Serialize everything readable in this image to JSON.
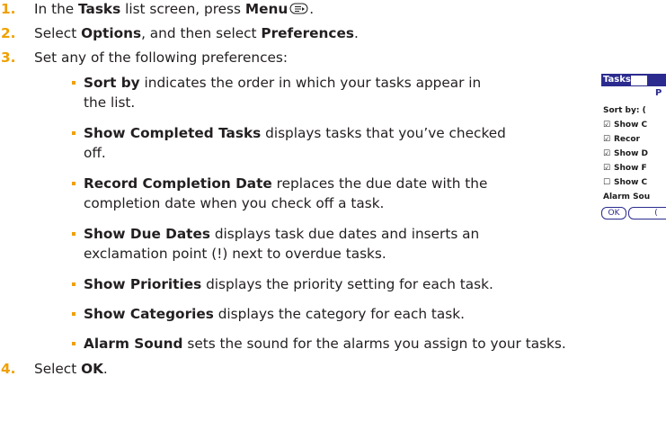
{
  "steps": [
    {
      "num": "1.",
      "pre": "In the ",
      "b1": "Tasks",
      "mid": " list screen, press ",
      "b2": "Menu",
      "post": "."
    },
    {
      "num": "2.",
      "pre": "Select ",
      "b1": "Options",
      "mid": ", and then select ",
      "b2": "Preferences",
      "post": "."
    },
    {
      "num": "3.",
      "text": "Set any of the following preferences:"
    },
    {
      "num": "4.",
      "pre": "Select ",
      "b1": "OK",
      "post": "."
    }
  ],
  "prefs": [
    {
      "term": "Sort by",
      "lines": [
        " indicates the order in which your tasks appear in",
        "the list."
      ]
    },
    {
      "term": "Show Completed Tasks",
      "lines": [
        " displays tasks that you’ve checked",
        "off."
      ]
    },
    {
      "term": "Record Completion Date",
      "lines": [
        " replaces the due date with the",
        "completion date when you check off a task."
      ]
    },
    {
      "term": "Show Due Dates",
      "lines": [
        " displays task due dates and inserts an",
        "exclamation point (!) next to overdue tasks."
      ]
    },
    {
      "term": "Show Priorities",
      "lines": [
        " displays the priority setting for each task."
      ]
    },
    {
      "term": "Show Categories",
      "lines": [
        " displays the category for each task."
      ]
    },
    {
      "term": "Alarm Sound",
      "lines": [
        " sets the sound for the alarms you assign to your tasks."
      ]
    }
  ],
  "device": {
    "title": "Tasks",
    "header": "P",
    "rows": [
      {
        "check": "",
        "label": "Sort by:  ("
      },
      {
        "check": "☑",
        "label": "Show C"
      },
      {
        "check": "☑",
        "label": "Recor"
      },
      {
        "check": "☑",
        "label": "Show D"
      },
      {
        "check": "☑",
        "label": "Show F"
      },
      {
        "check": "☐",
        "label": "Show C"
      },
      {
        "check": "",
        "label": "Alarm Sou"
      }
    ],
    "ok_label": "OK",
    "cancel_label": "("
  },
  "colors": {
    "accent": "#f0a000",
    "text": "#231f20",
    "device_blue": "#2b2b8f"
  },
  "icons": {
    "menu": "menu-icon"
  }
}
